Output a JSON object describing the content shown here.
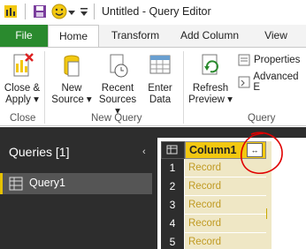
{
  "window": {
    "title": "Untitled - Query Editor"
  },
  "quick_access": {
    "save_icon": "save-icon",
    "smiley_icon": "smiley-icon",
    "dropdown_icon": "chevron-down-icon"
  },
  "tabs": [
    {
      "label": "File"
    },
    {
      "label": "Home"
    },
    {
      "label": "Transform"
    },
    {
      "label": "Add Column"
    },
    {
      "label": "View"
    }
  ],
  "ribbon": {
    "close_apply": {
      "line1": "Close &",
      "line2": "Apply ▾"
    },
    "close_group": "Close",
    "new_source": {
      "line1": "New",
      "line2": "Source ▾"
    },
    "recent_sources": {
      "line1": "Recent",
      "line2": "Sources ▾"
    },
    "enter_data": {
      "line1": "Enter",
      "line2": "Data"
    },
    "new_query_group": "New Query",
    "refresh_preview": {
      "line1": "Refresh",
      "line2": "Preview ▾"
    },
    "properties": "Properties",
    "advanced_editor": "Advanced E",
    "query_group": "Query"
  },
  "queries_pane": {
    "header": "Queries [1]",
    "collapse": "‹",
    "items": [
      {
        "label": "Query1"
      }
    ]
  },
  "grid": {
    "column_header": "Column1",
    "expand_label": "↔",
    "rows": [
      {
        "num": "1",
        "value": "Record"
      },
      {
        "num": "2",
        "value": "Record"
      },
      {
        "num": "3",
        "value": "Record"
      },
      {
        "num": "4",
        "value": "Record"
      },
      {
        "num": "5",
        "value": "Record"
      }
    ]
  },
  "colors": {
    "accent": "#2a8a2e",
    "header_yellow": "#f2c811",
    "dark_pane": "#2d2d2d",
    "annotation": "#e00000"
  }
}
